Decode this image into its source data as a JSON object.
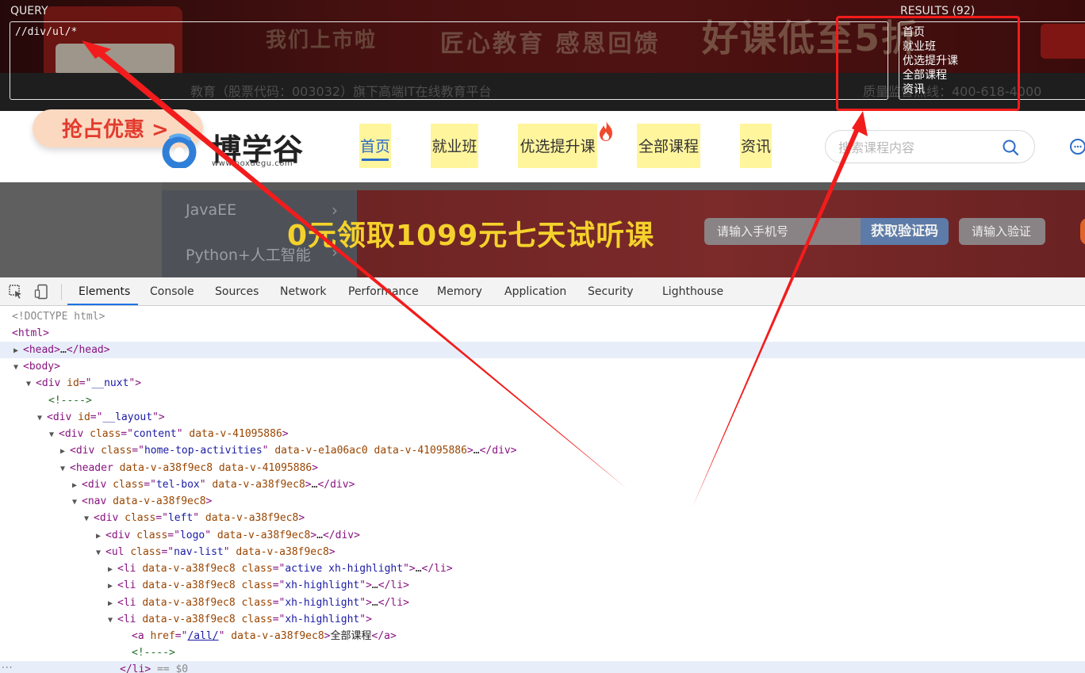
{
  "xpath_helper": {
    "query_label": "QUERY",
    "query_value": "//div/ul/*",
    "results_label": "RESULTS (92)",
    "results": [
      "首页",
      "就业班",
      "优选提升课",
      "全部课程",
      "资讯"
    ]
  },
  "banner": {
    "slogan1": "我们上市啦",
    "slogan2": "匠心教育 感恩回馈",
    "slogan3": "好课低至5折",
    "company_text": "教育（股票代码：003032）旗下高端IT在线教育平台",
    "hotline_text": "质量监督热线：400-618-4000"
  },
  "site": {
    "promo_label": "抢占优惠 >",
    "logo_text": "博学谷",
    "logo_url": "www.boxuegu.com",
    "nav_items": [
      {
        "label": "首页",
        "active": true
      },
      {
        "label": "就业班",
        "active": false
      },
      {
        "label": "优选提升课",
        "active": false
      },
      {
        "label": "全部课程",
        "active": false
      },
      {
        "label": "资讯",
        "active": false
      }
    ],
    "search_placeholder": "搜索课程内容",
    "accent_color": "#2a6cc7",
    "highlight_color": "#fff59d"
  },
  "hero": {
    "course_items": [
      "JavaEE",
      "Python+人工智能"
    ],
    "title": "0元领取1099元七天试听课",
    "phone_placeholder": "请输入手机号",
    "code_button": "获取验证码",
    "verify_placeholder": "请输入验证"
  },
  "devtools": {
    "tabs": [
      "Elements",
      "Console",
      "Sources",
      "Network",
      "Performance",
      "Memory",
      "Application",
      "Security",
      "Lighthouse"
    ],
    "active_tab": "Elements",
    "dom": {
      "doctype": "<!DOCTYPE html>",
      "html": "html",
      "head": "head",
      "body": "body",
      "div": "div",
      "id": "id",
      "class": "class",
      "nuxt": "__nuxt",
      "layout": "__layout",
      "content": "content",
      "dv_4109": "data-v-41095886",
      "home_top": "home-top-activities",
      "dv_e1a0": "data-v-e1a06ac0",
      "header": "header",
      "dv_a38f": "data-v-a38f9ec8",
      "tel_box": "tel-box",
      "nav": "nav",
      "left": "left",
      "logo": "logo",
      "ul": "ul",
      "nav_list": "nav-list",
      "li": "li",
      "active_hl": "active xh-highlight",
      "xh_hl": "xh-highlight",
      "a": "a",
      "href": "href",
      "href_val": "/all/",
      "link_text": "全部课程",
      "comment": "<!---->",
      "ellipsis": "…",
      "eq0": "== $0"
    }
  }
}
